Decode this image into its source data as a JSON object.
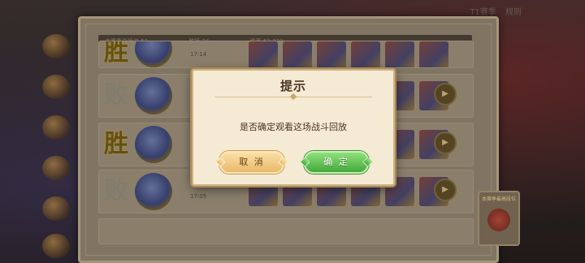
{
  "topbar": {
    "label_a": "T1赛季",
    "label_b": "规则"
  },
  "stats": {
    "label_1": "本赛季总场次 53",
    "label_2": "胜场 84",
    "label_3": "胜率 52.83%"
  },
  "rows": [
    {
      "result": "胜",
      "type": "win",
      "time": "17:14"
    },
    {
      "result": "败",
      "type": "lose",
      "time": ""
    },
    {
      "result": "胜",
      "type": "win",
      "time": ""
    },
    {
      "result": "败",
      "type": "lose",
      "time": "17:05"
    }
  ],
  "badge": {
    "label": "本赛季最高段位"
  },
  "dialog": {
    "title": "提示",
    "message": "是否确定观看这场战斗回放",
    "cancel_label": "取 消",
    "confirm_label": "确 定"
  },
  "colors": {
    "confirm": "#43a93a",
    "cancel": "#eab86a",
    "dialog_bg": "#f5ead4"
  }
}
